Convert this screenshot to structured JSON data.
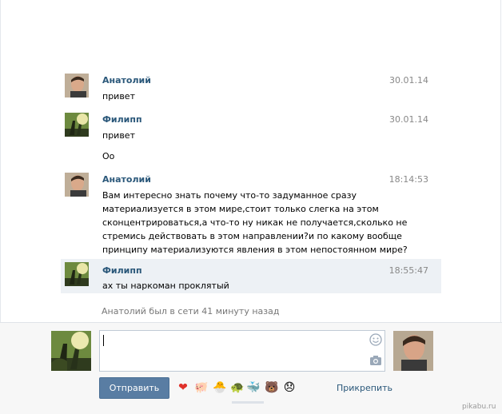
{
  "messages": [
    {
      "author": "Анатолий",
      "time": "30.01.14",
      "lines": [
        "привет"
      ]
    },
    {
      "author": "Филипп",
      "time": "30.01.14",
      "lines": [
        "привет",
        "",
        "Оо"
      ]
    },
    {
      "author": "Анатолий",
      "time": "18:14:53",
      "lines": [
        "Вам интересно знать почему что-то задуманное сразу",
        "материализуется в этом мире,стоит только слегка на этом",
        "сконцентрироваться,а что-то ну никак не получается,сколько не",
        "стремись действовать в этом направлении?и по какому вообще",
        "принципу материализуются явления в этом непостоянном мире?"
      ]
    },
    {
      "author": "Филипп",
      "time": "18:55:47",
      "lines": [
        "ах ты наркоман проклятый"
      ]
    }
  ],
  "status": "Анатолий был в сети 41 минуту назад",
  "composer": {
    "send_label": "Отправить",
    "attach_label": "Прикрепить",
    "emojis": [
      "heart",
      "pig",
      "hatching-chick",
      "turtle",
      "whale",
      "bear",
      "disappointed-face"
    ],
    "emoji_glyphs": [
      "❤",
      "🐖",
      "🐣",
      "🐢",
      "🐳",
      "🐻",
      "😞"
    ]
  },
  "watermark": "pikabu.ru",
  "colors": {
    "author": "#2b587a",
    "button": "#597da3",
    "highlight": "#edf1f5"
  }
}
